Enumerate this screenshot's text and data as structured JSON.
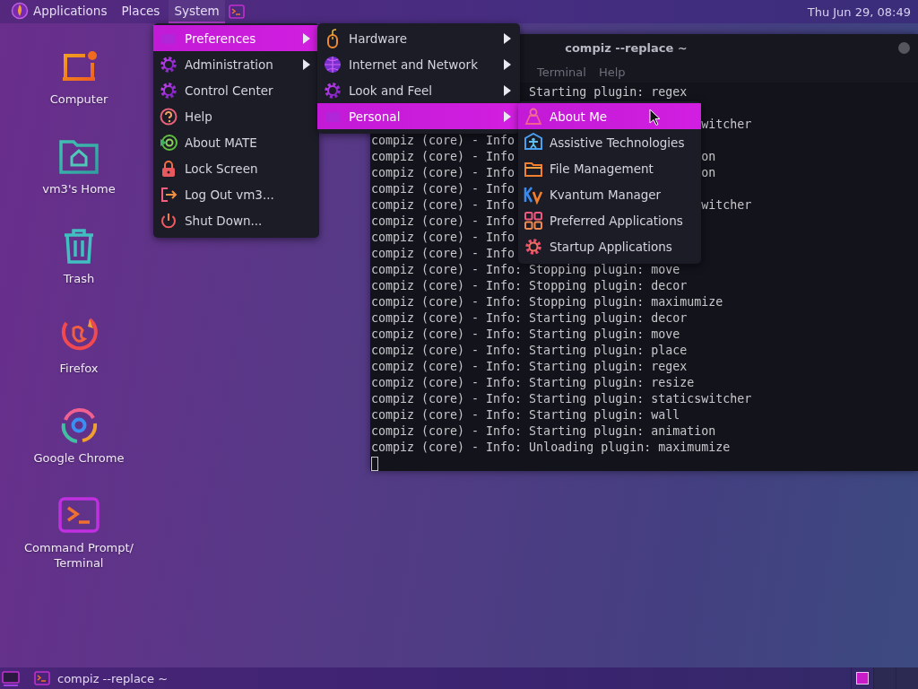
{
  "top_panel": {
    "menus": [
      {
        "label": "Applications",
        "selected": false
      },
      {
        "label": "Places",
        "selected": false
      },
      {
        "label": "System",
        "selected": true
      }
    ],
    "clock": "Thu Jun 29, 08:49"
  },
  "desktop_icons": [
    {
      "label": "Computer",
      "kind": "computer"
    },
    {
      "label": "vm3's Home",
      "kind": "home"
    },
    {
      "label": "Trash",
      "kind": "trash"
    },
    {
      "label": "Firefox",
      "kind": "firefox"
    },
    {
      "label": "Google Chrome",
      "kind": "chrome"
    },
    {
      "label": "Command Prompt/ Terminal",
      "kind": "terminal"
    }
  ],
  "terminal": {
    "title": "compiz --replace ~",
    "menus": [
      "Terminal",
      "Help"
    ],
    "lines": [
      {
        "message": "Starting plugin: regex"
      },
      {
        "kind": "blank"
      },
      {
        "end": "witcher"
      },
      {
        "info": "compiz (core) - Info"
      },
      {
        "info": "compiz (core) - Info",
        "end": "on"
      },
      {
        "info": "compiz (core) - Info",
        "end": "on"
      },
      {
        "info": "compiz (core) - Info"
      },
      {
        "info": "compiz (core) - Info",
        "end": "witcher"
      },
      {
        "info": "compiz (core) - Info"
      },
      {
        "info": "compiz (core) - Info"
      },
      {
        "info": "compiz (core) - Info"
      },
      {
        "info": "compiz (core) - Info:",
        "message": "Stopping plugin: move"
      },
      {
        "info": "compiz (core) - Info:",
        "message": "Stopping plugin: decor"
      },
      {
        "info": "compiz (core) - Info:",
        "message": "Stopping plugin: maximumize"
      },
      {
        "info": "compiz (core) - Info:",
        "message": "Starting plugin: decor"
      },
      {
        "info": "compiz (core) - Info:",
        "message": "Starting plugin: move"
      },
      {
        "info": "compiz (core) - Info:",
        "message": "Starting plugin: place"
      },
      {
        "info": "compiz (core) - Info:",
        "message": "Starting plugin: regex"
      },
      {
        "info": "compiz (core) - Info:",
        "message": "Starting plugin: resize"
      },
      {
        "info": "compiz (core) - Info:",
        "message": "Starting plugin: staticswitcher"
      },
      {
        "info": "compiz (core) - Info:",
        "message": "Starting plugin: wall"
      },
      {
        "info": "compiz (core) - Info:",
        "message": "Starting plugin: animation"
      },
      {
        "info": "compiz (core) - Info:",
        "message": "Unloading plugin: maximumize"
      }
    ]
  },
  "menus": [
    {
      "items": [
        {
          "label": "Preferences",
          "kind": "faint",
          "submenu": true,
          "selected": true
        },
        {
          "label": "Administration",
          "kind": "gear",
          "submenu": true,
          "selected": false
        },
        {
          "label": "Control Center",
          "kind": "gear",
          "submenu": false,
          "selected": false
        },
        {
          "label": "Help",
          "kind": "help",
          "submenu": false,
          "selected": false
        },
        {
          "label": "About MATE",
          "kind": "about",
          "submenu": false,
          "selected": false
        },
        {
          "label": "Lock Screen",
          "kind": "lock",
          "submenu": false,
          "selected": false
        },
        {
          "label": "Log Out vm3...",
          "kind": "logout",
          "submenu": false,
          "selected": false
        },
        {
          "label": "Shut Down...",
          "kind": "power",
          "submenu": false,
          "selected": false
        }
      ]
    },
    {
      "items": [
        {
          "label": "Hardware",
          "kind": "mouse",
          "submenu": true,
          "selected": false
        },
        {
          "label": "Internet and Network",
          "kind": "globe",
          "submenu": true,
          "selected": false
        },
        {
          "label": "Look and Feel",
          "kind": "gear",
          "submenu": true,
          "selected": false
        },
        {
          "label": "Personal",
          "kind": "faint",
          "submenu": true,
          "selected": true
        }
      ]
    },
    {
      "items": [
        {
          "label": "About Me",
          "kind": "person",
          "submenu": false,
          "selected": true
        },
        {
          "label": "Assistive Technologies",
          "kind": "accessibility",
          "submenu": false,
          "selected": false
        },
        {
          "label": "File Management",
          "kind": "folder",
          "submenu": false,
          "selected": false
        },
        {
          "label": "Kvantum Manager",
          "kind": "kvantum",
          "submenu": false,
          "selected": false
        },
        {
          "label": "Preferred Applications",
          "kind": "grid",
          "submenu": false,
          "selected": false
        },
        {
          "label": "Startup Applications",
          "kind": "startup",
          "submenu": false,
          "selected": false
        }
      ]
    }
  ],
  "taskbar": {
    "windows": [
      {
        "label": "compiz --replace ~",
        "selected": false
      }
    ],
    "workspaces": [
      {
        "selected": true
      },
      {
        "selected": false
      },
      {
        "selected": false
      }
    ]
  }
}
